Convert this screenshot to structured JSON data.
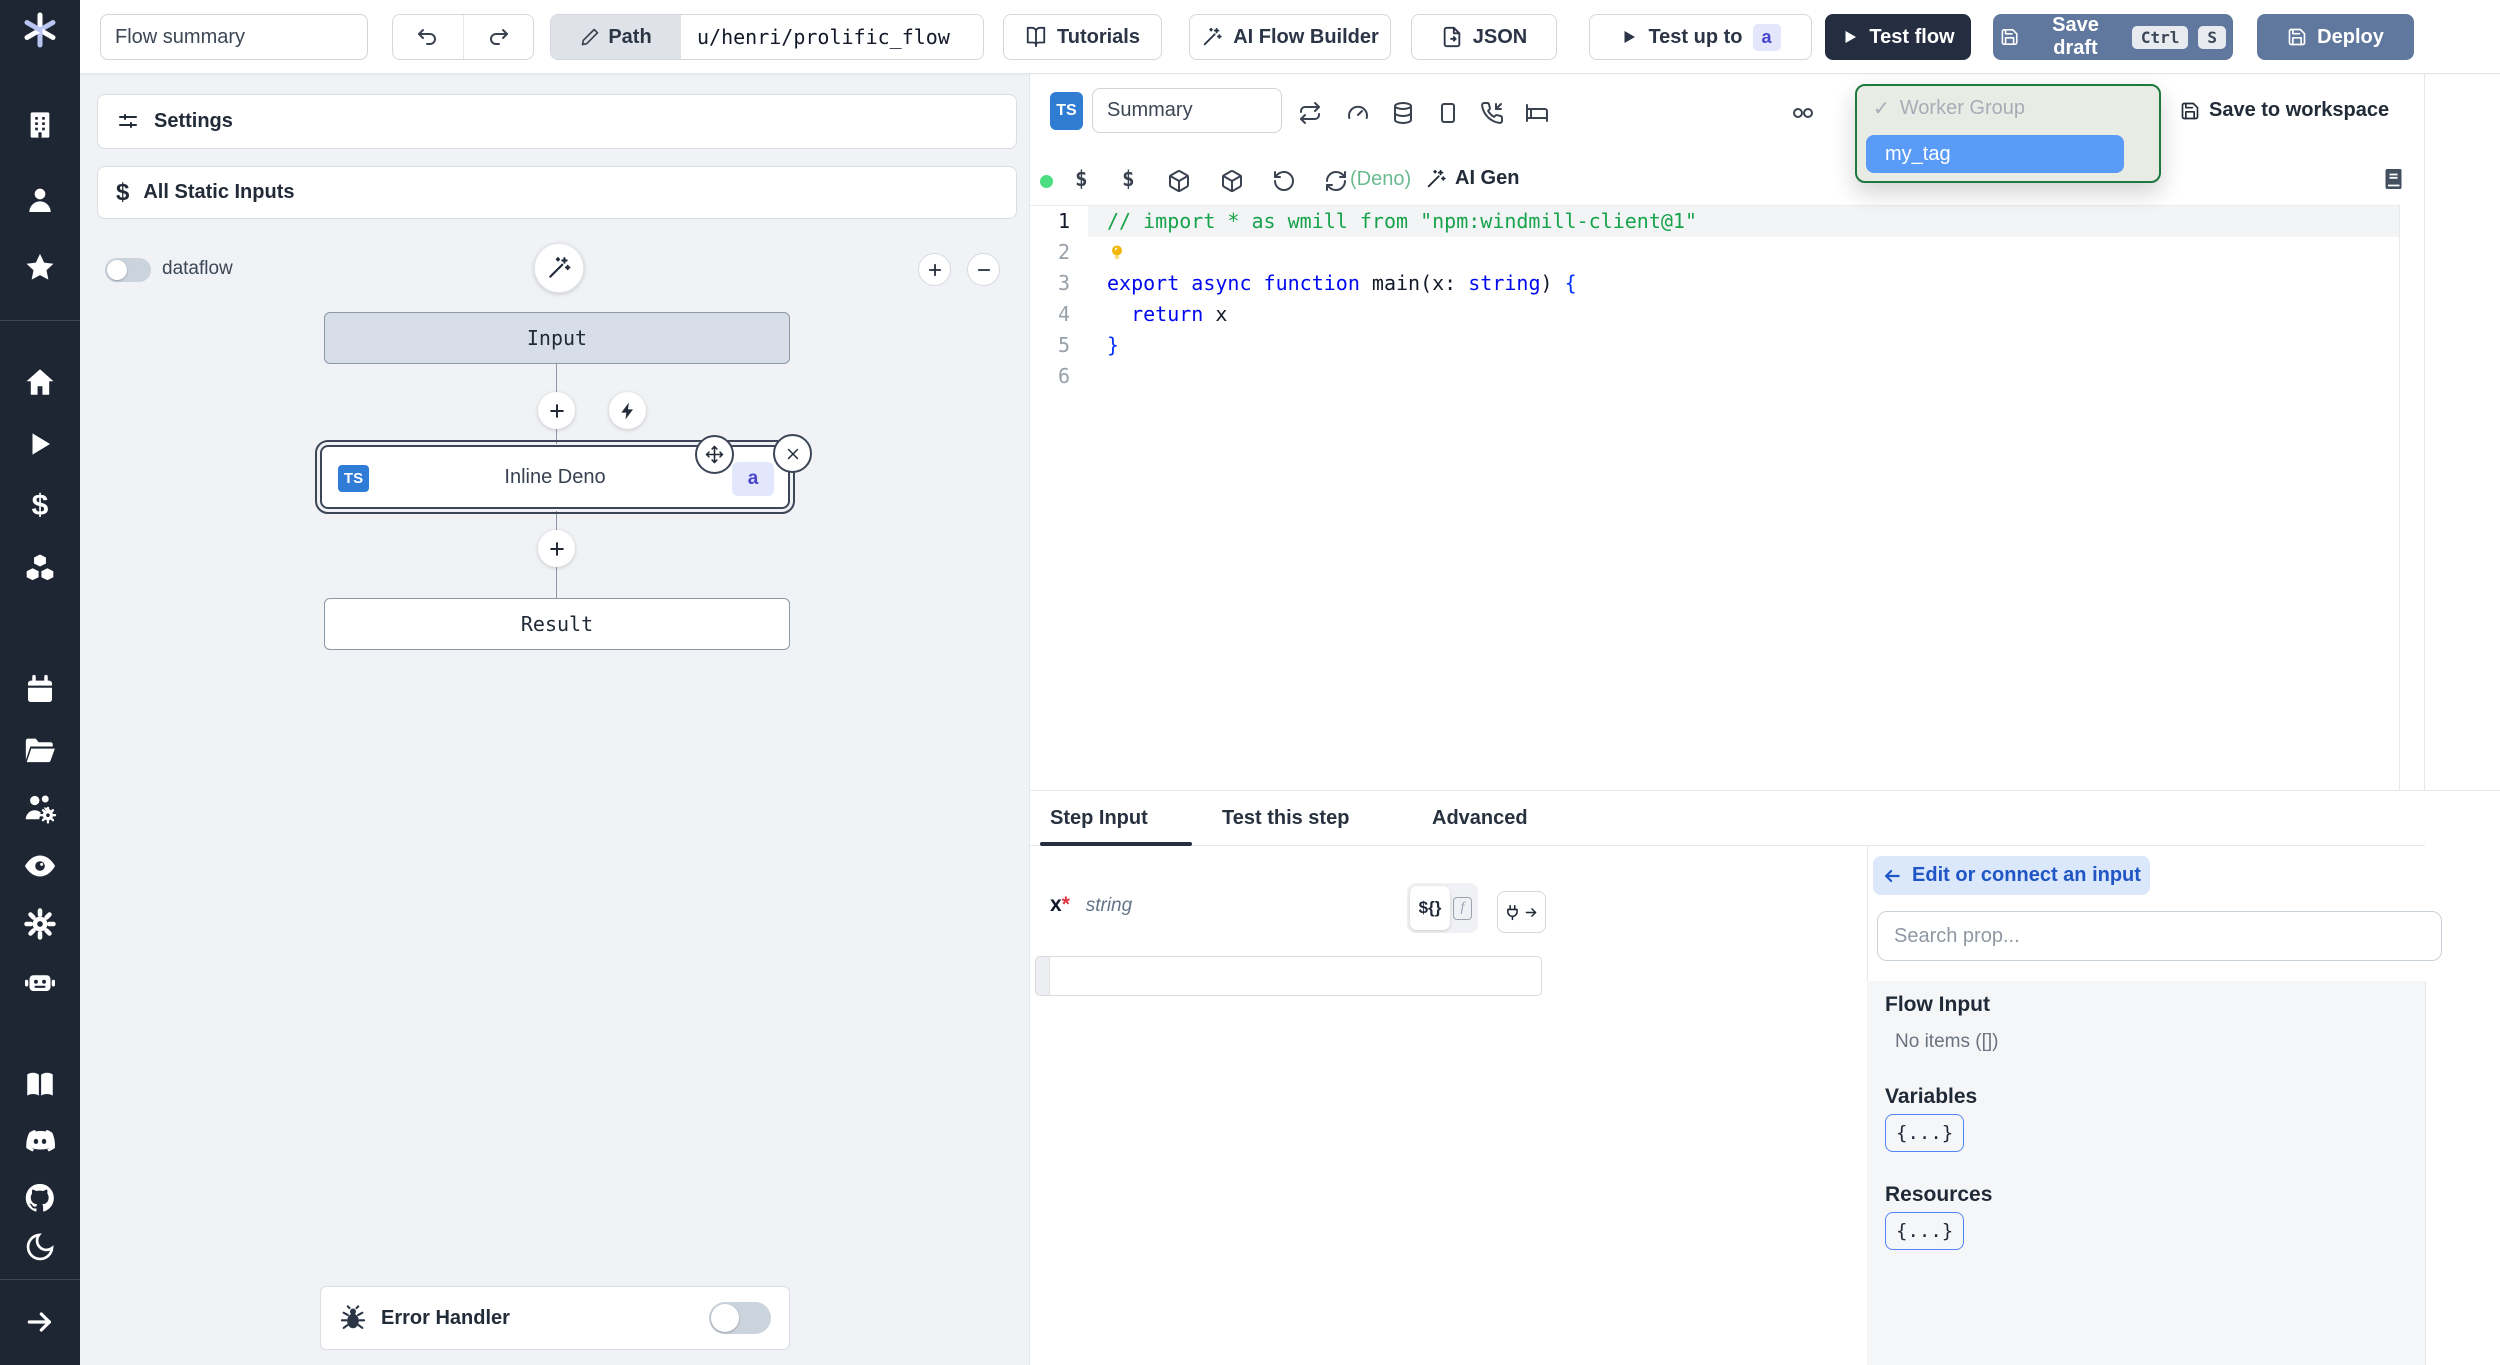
{
  "header": {
    "flow_summary_placeholder": "Flow summary",
    "path_label": "Path",
    "path_value": "u/henri/prolific_flow",
    "tutorials_label": "Tutorials",
    "ai_flow_builder_label": "AI Flow Builder",
    "json_label": "JSON",
    "test_up_to_label": "Test up to",
    "test_up_to_badge": "a",
    "test_flow_label": "Test flow",
    "save_draft_label": "Save draft",
    "save_draft_kbd": [
      "Ctrl",
      "S"
    ],
    "deploy_label": "Deploy"
  },
  "sidebar": {
    "icons": [
      "windmill-logo",
      "building",
      "user",
      "star",
      "home",
      "play",
      "dollar",
      "cubes",
      "calendar",
      "folder",
      "user-group-gear",
      "eye",
      "gear",
      "robot",
      "book",
      "discord",
      "github",
      "moon",
      "arrow-right"
    ]
  },
  "flow_panel": {
    "settings_label": "Settings",
    "static_inputs_icon": "$",
    "static_inputs_label": "All Static Inputs",
    "dataflow_label": "dataflow",
    "nodes": {
      "input": "Input",
      "step_title": "Inline Deno",
      "step_lang_badge": "TS",
      "step_id_badge": "a",
      "result": "Result"
    },
    "error_handler_label": "Error Handler"
  },
  "editor": {
    "language_badge": "TS",
    "summary_placeholder": "Summary",
    "toolbar_icons_row1": [
      "repeat",
      "gauge",
      "database",
      "smartphone",
      "phone-incoming",
      "bed",
      "cable"
    ],
    "toolbar_icons_row2": [
      "status-dot",
      "dollar",
      "dollar",
      "package",
      "package",
      "rotate-ccw",
      "refresh-cw",
      "library"
    ],
    "language_hint": "(Deno)",
    "ai_gen_label": "AI Gen",
    "save_to_workspace_label": "Save to workspace",
    "worker_group_dropdown": {
      "check": "✓",
      "group_label": "Worker Group",
      "selected_tag": "my_tag"
    },
    "code": {
      "lines": [
        {
          "num": "1",
          "tokens": [
            {
              "text": "// import * as wmill from \"npm:windmill-client@1\"",
              "style": "comment"
            }
          ]
        },
        {
          "num": "2",
          "tokens": []
        },
        {
          "num": "3",
          "tokens": [
            {
              "text": "export async function ",
              "style": "keyword"
            },
            {
              "text": "main",
              "style": "plain"
            },
            {
              "text": "(x: ",
              "style": "plain"
            },
            {
              "text": "string",
              "style": "keyword"
            },
            {
              "text": ") ",
              "style": "plain"
            },
            {
              "text": "{",
              "style": "brace"
            }
          ]
        },
        {
          "num": "4",
          "tokens": [
            {
              "text": "  ",
              "style": "plain"
            },
            {
              "text": "return",
              "style": "keyword"
            },
            {
              "text": " x",
              "style": "plain"
            }
          ]
        },
        {
          "num": "5",
          "tokens": [
            {
              "text": "}",
              "style": "brace"
            }
          ]
        },
        {
          "num": "6",
          "tokens": []
        }
      ]
    }
  },
  "bottom_panel": {
    "tabs": [
      {
        "label": "Step Input"
      },
      {
        "label": "Test this step"
      },
      {
        "label": "Advanced"
      }
    ],
    "field": {
      "name": "x",
      "required_marker": "*",
      "type": "string",
      "template_toggle": "${}",
      "fn_toggle": "f"
    },
    "prop_picker": {
      "connect_arrow": "←",
      "connect_button_label": "Edit or connect an input",
      "search_placeholder": "Search prop...",
      "flow_input_label": "Flow Input",
      "flow_input_empty": "No items ([])",
      "variables_label": "Variables",
      "resources_label": "Resources",
      "object_chip": "{...}"
    }
  },
  "colors": {
    "sidebar_bg": "#1e2533",
    "ts_badge_blue": "#2f7cd2",
    "action_button_slate": "#61789e",
    "dark_button": "#242e40",
    "selected_tag_blue": "#5a9bf7",
    "dropdown_focus_green": "#1d7a3f",
    "deno_hint_green": "#6cbb90",
    "status_dot_green": "#4ade80"
  }
}
